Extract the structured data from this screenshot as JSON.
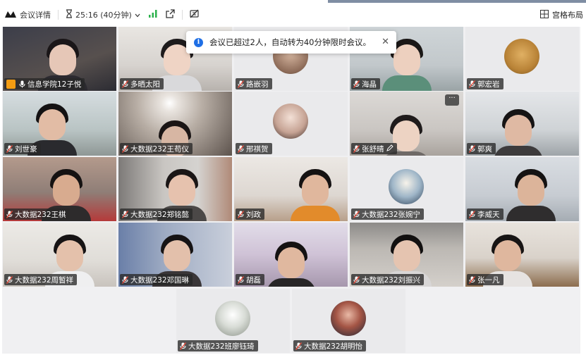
{
  "toolbar": {
    "meeting_info_label": "会议详情",
    "timer_text": "25:16 (40分钟)",
    "layout_label": "宫格布局"
  },
  "banner": {
    "message": "会议已超过2人，自动转为40分钟限时会议。",
    "info_glyph": "i",
    "close_glyph": "✕"
  },
  "participants": [
    {
      "name": "信息学院12子悦"
    },
    {
      "name": "多晒太阳"
    },
    {
      "name": "路嵌羽"
    },
    {
      "name": "海晶"
    },
    {
      "name": "郭宏岩"
    },
    {
      "name": "刘世豪"
    },
    {
      "name": "大数据232王苟仪"
    },
    {
      "name": "邢祺贺"
    },
    {
      "name": "张舒晴"
    },
    {
      "name": "郭爽"
    },
    {
      "name": "大数据232王棋"
    },
    {
      "name": "大数据232郑铭懿"
    },
    {
      "name": "刘政"
    },
    {
      "name": "大数据232张婉宁"
    },
    {
      "name": "李威天"
    },
    {
      "name": "大数据232周暂祥"
    },
    {
      "name": "大数据232邓国琳"
    },
    {
      "name": "胡磊"
    },
    {
      "name": "大数据232刘振兴"
    },
    {
      "name": "张一凡"
    },
    {
      "name": "大数据232班廖钰琦"
    },
    {
      "name": "大数据232胡明怡"
    }
  ],
  "tile_more_glyph": "···",
  "colors": {
    "accent_blue": "#1f6fe5",
    "signal_green": "#2bb24c",
    "host_orange": "#f39c12"
  },
  "icons": [
    "logo-icon",
    "hourglass-icon",
    "chevron-down-icon",
    "signal-icon",
    "share-icon",
    "no-record-icon",
    "grid-layout-icon",
    "mic-muted-icon",
    "info-icon",
    "close-icon"
  ]
}
